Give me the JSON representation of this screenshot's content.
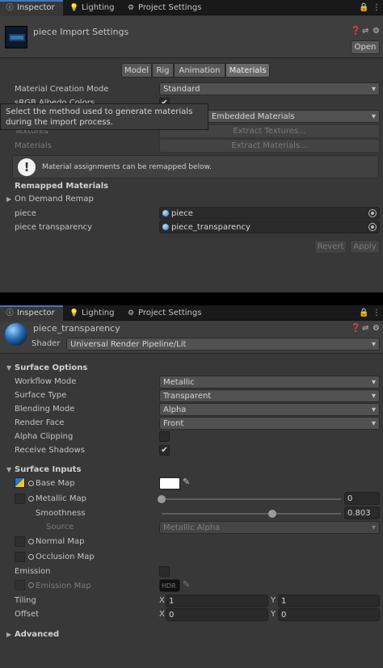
{
  "top": {
    "tabs": [
      {
        "label": "Inspector",
        "icon": "info-icon"
      },
      {
        "label": "Lighting",
        "icon": "bulb-icon"
      },
      {
        "label": "Project Settings",
        "icon": "gear-icon"
      }
    ],
    "title": "piece Import Settings",
    "open_button": "Open",
    "asset_tabs": [
      "Model",
      "Rig",
      "Animation",
      "Materials"
    ],
    "active_asset_tab": "Materials",
    "material_creation_mode": {
      "label": "Material Creation Mode",
      "value": "Standard"
    },
    "hidden_row_label": "sRGB Albedo Colors",
    "location": {
      "value": "Use Embedded Materials"
    },
    "tooltip": "Select the method used to generate materials during the import process.",
    "textures": {
      "label": "Textures",
      "button": "Extract Textures..."
    },
    "materials": {
      "label": "Materials",
      "button": "Extract Materials..."
    },
    "help_text": "Material assignments can be remapped below.",
    "remapped_title": "Remapped Materials",
    "on_demand": "On Demand Remap",
    "remaps": [
      {
        "label": "piece",
        "value": "piece"
      },
      {
        "label": "piece transparency",
        "value": "piece_transparency"
      }
    ],
    "revert": "Revert",
    "apply": "Apply"
  },
  "bottom": {
    "tabs": [
      {
        "label": "Inspector",
        "icon": "info-icon"
      },
      {
        "label": "Lighting",
        "icon": "bulb-icon"
      },
      {
        "label": "Project Settings",
        "icon": "gear-icon"
      }
    ],
    "title": "piece_transparency",
    "shader_label": "Shader",
    "shader_value": "Universal Render Pipeline/Lit",
    "surface_options": "Surface Options",
    "workflow": {
      "label": "Workflow Mode",
      "value": "Metallic"
    },
    "surface_type": {
      "label": "Surface Type",
      "value": "Transparent"
    },
    "blending": {
      "label": "Blending Mode",
      "value": "Alpha"
    },
    "render_face": {
      "label": "Render Face",
      "value": "Front"
    },
    "alpha_clipping": {
      "label": "Alpha Clipping",
      "checked": false
    },
    "receive_shadows": {
      "label": "Receive Shadows",
      "checked": true,
      "mark": "✔"
    },
    "surface_inputs": "Surface Inputs",
    "base_map": "Base Map",
    "base_color": "#ffffff",
    "metallic": {
      "label": "Metallic Map",
      "value": "0",
      "fraction": 0
    },
    "smoothness": {
      "label": "Smoothness",
      "value": "0.803",
      "fraction": 0.803
    },
    "source": {
      "label": "Source",
      "value": "Metallic Alpha"
    },
    "normal_map": "Normal Map",
    "occlusion_map": "Occlusion Map",
    "emission": {
      "label": "Emission",
      "checked": false
    },
    "emission_map": "Emission Map",
    "hdr": "HDR",
    "tiling": {
      "label": "Tiling",
      "x_label": "X",
      "x": "1",
      "y_label": "Y",
      "y": "1"
    },
    "offset": {
      "label": "Offset",
      "x_label": "X",
      "x": "0",
      "y_label": "Y",
      "y": "0"
    },
    "advanced": "Advanced"
  },
  "colors": {
    "accent": "#3a79bb",
    "background": "#383838",
    "field": "#2a2a2a"
  }
}
